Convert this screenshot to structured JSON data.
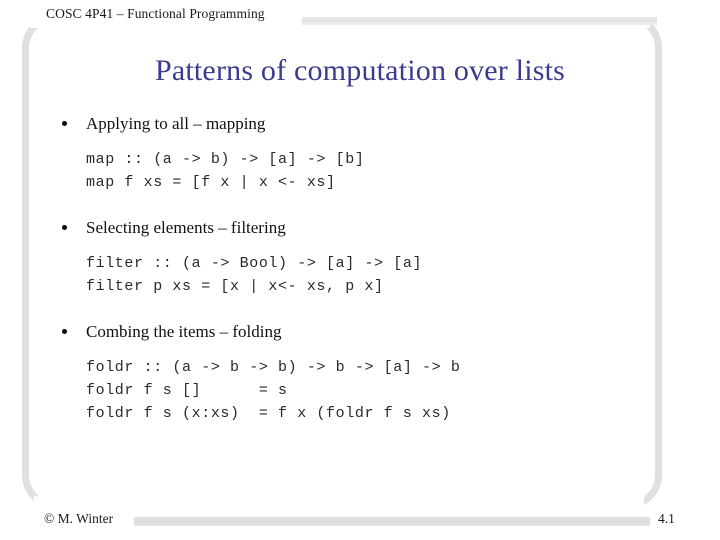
{
  "header": {
    "course_label": "COSC 4P41 – Functional Programming"
  },
  "title": "Patterns of computation over lists",
  "body": {
    "sections": [
      {
        "bullet": "Applying to all – mapping",
        "code": [
          "map :: (a -> b) -> [a] -> [b]",
          "map f xs = [f x | x <- xs]"
        ]
      },
      {
        "bullet": "Selecting elements – filtering",
        "code": [
          "filter :: (a -> Bool) -> [a] -> [a]",
          "filter p xs = [x | x<- xs, p x]"
        ]
      },
      {
        "bullet": "Combing the items – folding",
        "code": [
          "foldr :: (a -> b -> b) -> b -> [a] -> b",
          "foldr f s []      = s",
          "foldr f s (x:xs)  = f x (foldr f s xs)"
        ]
      }
    ]
  },
  "footer": {
    "copyright": "© M. Winter",
    "page_number": "4.1"
  },
  "colors": {
    "title": "#3b3b8f",
    "frame": "#e0e0e0",
    "bar": "#e0e0e0",
    "text": "#111111",
    "background": "#ffffff"
  }
}
